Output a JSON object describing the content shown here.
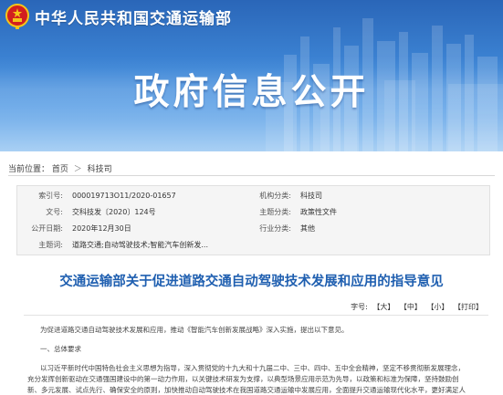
{
  "site": {
    "title": "中华人民共和国交通运输部",
    "banner_heading": "政府信息公开"
  },
  "breadcrumb": {
    "prefix": "当前位置：",
    "items": [
      "首页",
      "科技司"
    ],
    "separator": "＞"
  },
  "info": {
    "left": [
      {
        "label": "索引号:",
        "value": "000019713O11/2020-01657"
      },
      {
        "label": "文号:",
        "value": "交科技发〔2020〕124号"
      },
      {
        "label": "公开日期:",
        "value": "2020年12月30日"
      },
      {
        "label": "主题词:",
        "value": "道路交通;自动驾驶技术;智能汽车创新发..."
      }
    ],
    "right": [
      {
        "label": "机构分类:",
        "value": "科技司"
      },
      {
        "label": "主题分类:",
        "value": "政策性文件"
      },
      {
        "label": "行业分类:",
        "value": "其他"
      }
    ]
  },
  "article": {
    "title": "交通运输部关于促进道路交通自动驾驶技术发展和应用的指导意见",
    "font_size_label": "字号:",
    "font_options": [
      "【大】",
      "【中】",
      "【小】",
      "【打印】"
    ],
    "paragraphs": [
      "为促进道路交通自动驾驶技术发展和应用，推动《智能汽车创新发展战略》深入实施，提出以下意见。",
      "一、总体要求",
      "以习近平新时代中国特色社会主义思想为指导，深入贯彻党的十九大和十九届二中、三中、四中、五中全会精神，坚定不移贯彻新发展理念，",
      "充分发挥创新驱动在交通强国建设中的第一动力作用，以关键技术研发为支撑，以典型场景应用示范为先导，以政策和标准为保障，坚持鼓励创",
      "新、多元发展、试点先行、确保安全的原则，加快推动自动驾驶技术在我国道路交通运输中发展应用，全面提升交通运输现代化水平，更好满足人"
    ]
  },
  "colors": {
    "banner_top": "#2a66b8",
    "banner_bottom": "#a9d0f4",
    "title_blue": "#1f5fb0",
    "emblem_red": "#d21f1f",
    "emblem_gold": "#f5c518"
  },
  "icons": {
    "emblem": "national-emblem-icon"
  }
}
